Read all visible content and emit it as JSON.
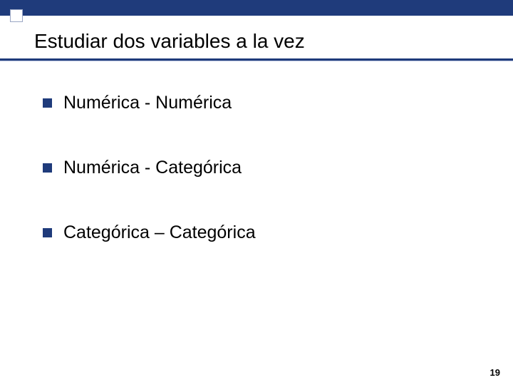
{
  "header": {
    "title": "Estudiar dos variables a la vez"
  },
  "content": {
    "items": [
      {
        "label": "Numérica - Numérica"
      },
      {
        "label": "Numérica - Categórica"
      },
      {
        "label": "Categórica – Categórica"
      }
    ]
  },
  "footer": {
    "page_number": "19"
  },
  "theme": {
    "accent": "#1f3b7b"
  }
}
